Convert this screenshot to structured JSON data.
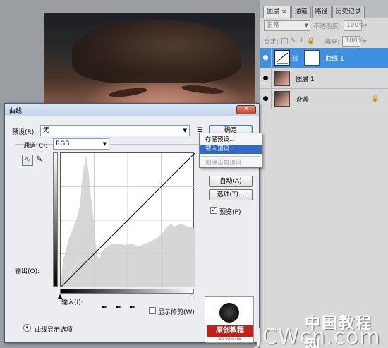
{
  "layers_panel": {
    "tabs": [
      {
        "label": "图层",
        "close": "×"
      },
      {
        "label": "通道"
      },
      {
        "label": "路径"
      },
      {
        "label": "历史记录"
      }
    ],
    "blend_mode": "正常",
    "opacity_label": "不透明度:",
    "opacity_value": "100%",
    "lock_label": "锁定:",
    "fill_label": "填充:",
    "fill_value": "100%",
    "layers": [
      {
        "name": "曲线 1",
        "selected": true
      },
      {
        "name": "图层 1",
        "selected": false
      },
      {
        "name": "背景",
        "selected": false
      }
    ]
  },
  "curves_dialog": {
    "title": "曲线",
    "close": "✕",
    "preset_label": "预设(R):",
    "preset_value": "无",
    "channel_label": "通道(C):",
    "channel_value": "RGB",
    "output_label": "输出(O):",
    "input_label": "输入(I):",
    "show_clipping_label": "显示修剪(W)",
    "curve_options_label": "曲线显示选项",
    "buttons": {
      "ok": "确定",
      "auto": "自动(A)",
      "options": "选项(T)...",
      "preview": "预览(P)"
    },
    "preview_checked": true,
    "show_clipping_checked": false
  },
  "preset_menu": {
    "items": [
      {
        "label": "存储预设...",
        "highlighted": false,
        "disabled": false
      },
      {
        "label": "载入预设...",
        "highlighted": true,
        "disabled": false
      },
      {
        "label": "删除当前预设",
        "highlighted": false,
        "disabled": true
      }
    ]
  },
  "watermark": {
    "badge_text": "原创教程",
    "badge_url": "BBS.16XX8.COM",
    "cn": "中国教程网",
    "en": "JCWcn.com"
  },
  "colors": {
    "selected_layer": "#3f8fe3",
    "menu_highlight": "#3169c6",
    "badge_red": "#c61f18"
  }
}
